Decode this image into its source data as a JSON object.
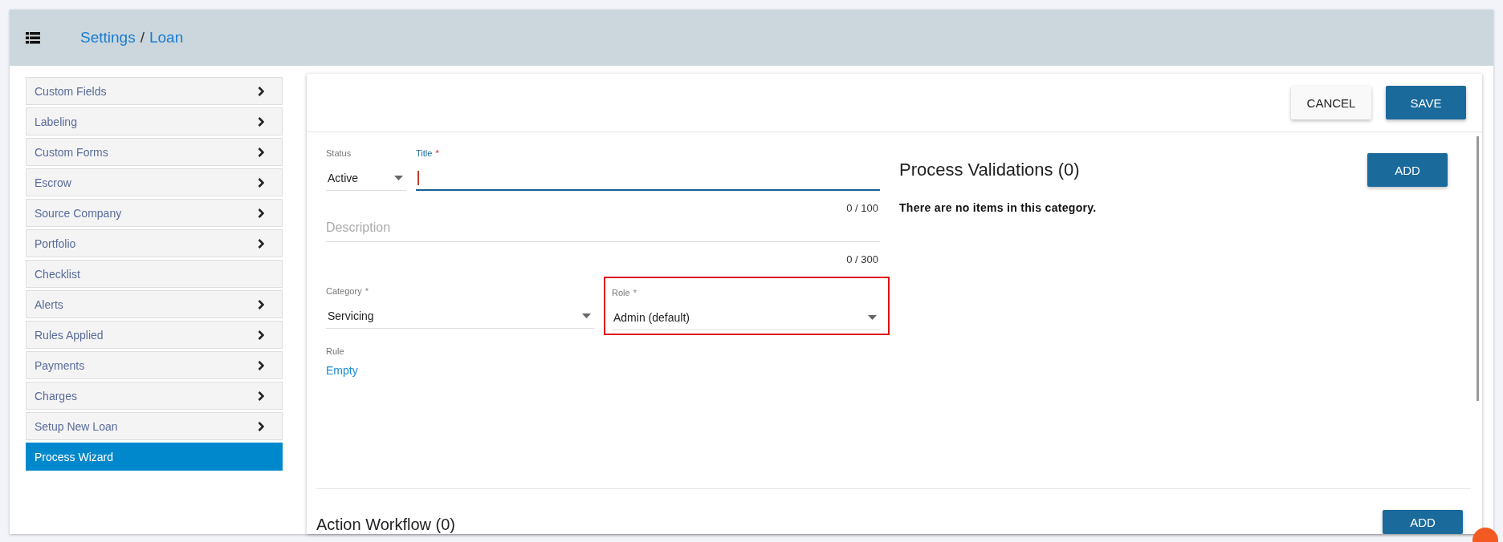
{
  "header": {
    "breadcrumb": [
      {
        "label": "Settings",
        "separator": "/"
      },
      {
        "label": "Loan"
      }
    ]
  },
  "sidebar": {
    "items": [
      {
        "label": "Custom Fields",
        "has_arrow": true,
        "selected": false
      },
      {
        "label": "Labeling",
        "has_arrow": true,
        "selected": false
      },
      {
        "label": "Custom Forms",
        "has_arrow": true,
        "selected": false
      },
      {
        "label": "Escrow",
        "has_arrow": true,
        "selected": false
      },
      {
        "label": "Source Company",
        "has_arrow": true,
        "selected": false
      },
      {
        "label": "Portfolio",
        "has_arrow": true,
        "selected": false
      },
      {
        "label": "Checklist",
        "has_arrow": false,
        "selected": false
      },
      {
        "label": "Alerts",
        "has_arrow": true,
        "selected": false
      },
      {
        "label": "Rules Applied",
        "has_arrow": true,
        "selected": false
      },
      {
        "label": "Payments",
        "has_arrow": true,
        "selected": false
      },
      {
        "label": "Charges",
        "has_arrow": true,
        "selected": false
      },
      {
        "label": "Setup New Loan",
        "has_arrow": true,
        "selected": false
      },
      {
        "label": "Process Wizard",
        "has_arrow": false,
        "selected": true
      }
    ]
  },
  "toolbar": {
    "buttons": [
      {
        "label": "CANCEL",
        "kind": "secondary"
      },
      {
        "label": "SAVE",
        "kind": "primary"
      }
    ]
  },
  "form": {
    "status": {
      "label": "Status",
      "value": "Active"
    },
    "title": {
      "label": "Title",
      "mark": "*",
      "focused": true,
      "counter": "0 / 100"
    },
    "description": {
      "placeholder": "Description",
      "counter": "0 / 300"
    },
    "category": {
      "label": "Category",
      "mark": "*",
      "value": "Servicing"
    },
    "role": {
      "label": "Role",
      "mark": "*",
      "value": "Admin (default)",
      "highlighted": true
    },
    "rule": {
      "label": "Rule",
      "value": "Empty"
    }
  },
  "validations": {
    "title": "Process Validations (0)",
    "add_label": "ADD",
    "empty_text": "There are no items in this category."
  },
  "workflow": {
    "title": "Action Workflow (0)",
    "add_label": "ADD"
  }
}
